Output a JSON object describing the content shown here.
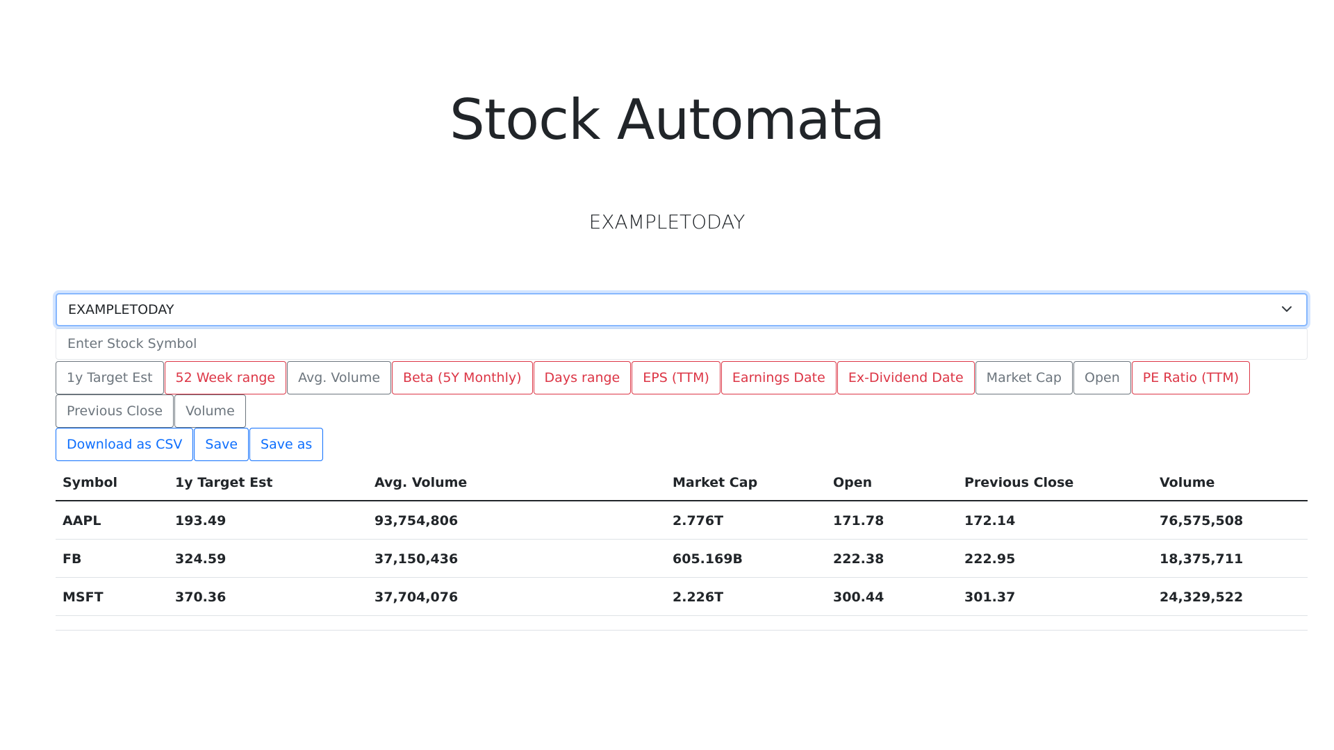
{
  "app": {
    "title": "Stock Automata",
    "list_name": "EXAMPLETODAY"
  },
  "list_select": {
    "selected": "EXAMPLETODAY",
    "icon": "chevron-down-icon"
  },
  "symbol_input": {
    "placeholder": "Enter Stock Symbol",
    "value": ""
  },
  "field_buttons": [
    {
      "label": "1y Target Est",
      "active": true
    },
    {
      "label": "52 Week range",
      "active": false
    },
    {
      "label": "Avg. Volume",
      "active": true
    },
    {
      "label": "Beta (5Y Monthly)",
      "active": false
    },
    {
      "label": "Days range",
      "active": false
    },
    {
      "label": "EPS (TTM)",
      "active": false
    },
    {
      "label": "Earnings Date",
      "active": false
    },
    {
      "label": "Ex-Dividend Date",
      "active": false
    },
    {
      "label": "Market Cap",
      "active": true
    },
    {
      "label": "Open",
      "active": true
    },
    {
      "label": "PE Ratio (TTM)",
      "active": false
    },
    {
      "label": "Previous Close",
      "active": true
    },
    {
      "label": "Volume",
      "active": true
    }
  ],
  "actions": {
    "download_csv": "Download as CSV",
    "save": "Save",
    "save_as": "Save as"
  },
  "table": {
    "columns": [
      "Symbol",
      "1y Target Est",
      "Avg. Volume",
      "Market Cap",
      "Open",
      "Previous Close",
      "Volume"
    ],
    "rows": [
      [
        "AAPL",
        "193.49",
        "93,754,806",
        "2.776T",
        "171.78",
        "172.14",
        "76,575,508"
      ],
      [
        "FB",
        "324.59",
        "37,150,436",
        "605.169B",
        "222.38",
        "222.95",
        "18,375,711"
      ],
      [
        "MSFT",
        "370.36",
        "37,704,076",
        "2.226T",
        "300.44",
        "301.37",
        "24,329,522"
      ]
    ]
  },
  "colors": {
    "active_field": "#6c757d",
    "inactive_field": "#dc3545",
    "primary": "#0d6efd",
    "text": "#212529"
  }
}
